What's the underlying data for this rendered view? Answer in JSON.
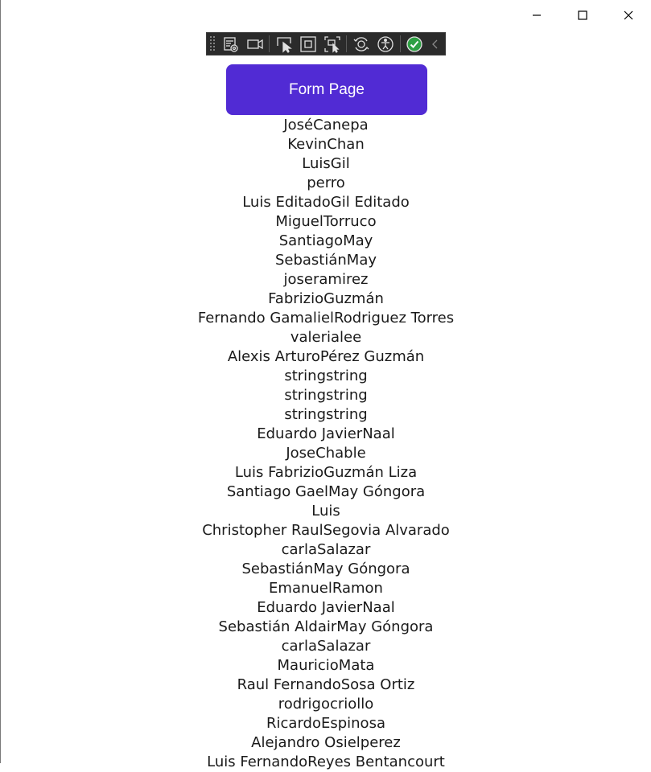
{
  "window": {
    "controls": {
      "minimize_icon": "minimize-icon",
      "maximize_icon": "maximize-icon",
      "close_icon": "close-icon"
    }
  },
  "debug_toolbar": {
    "icons": [
      "grip-handle",
      "live-visual-tree-icon",
      "video-camera-icon",
      "select-element-icon",
      "display-layout-adorners-icon",
      "track-focus-icon",
      "hot-reload-icon",
      "accessibility-icon",
      "binding-check-icon",
      "collapse-chevron-icon"
    ],
    "check_color": "#2ea043"
  },
  "main": {
    "form_button_label": "Form Page",
    "accent_color": "#512bd4",
    "names": [
      "JoséCanepa",
      "KevinChan",
      "LuisGil",
      "perro",
      "Luis EditadoGil Editado",
      "MiguelTorruco",
      "SantiagoMay",
      "SebastiánMay",
      "joseramirez",
      "FabrizioGuzmán",
      "Fernando GamalielRodriguez Torres",
      "valerialee",
      "Alexis ArturoPérez Guzmán",
      "stringstring",
      "stringstring",
      "stringstring",
      "Eduardo JavierNaal",
      "JoseChable",
      "Luis FabrizioGuzmán Liza",
      "Santiago GaelMay Góngora",
      "Luis",
      "Christopher RaulSegovia Alvarado",
      "carlaSalazar",
      "SebastiánMay Góngora",
      "EmanuelRamon",
      "Eduardo JavierNaal",
      "Sebastián AldairMay Góngora",
      "carlaSalazar",
      "MauricioMata",
      "Raul FernandoSosa Ortiz",
      "rodrigocriollo",
      "RicardoEspinosa",
      "Alejandro Osielperez",
      "Luis FernandoReyes Bentancourt"
    ]
  }
}
